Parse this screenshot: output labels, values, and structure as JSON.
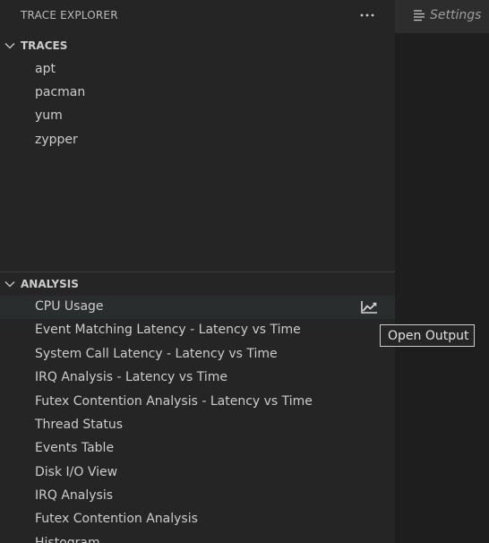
{
  "explorer": {
    "title": "TRACE EXPLORER",
    "more_icon": "ellipsis-icon"
  },
  "traces": {
    "title": "TRACES",
    "items": [
      "apt",
      "pacman",
      "yum",
      "zypper"
    ]
  },
  "analysis": {
    "title": "ANALYSIS",
    "items": [
      "CPU Usage",
      "Event Matching Latency - Latency vs Time",
      "System Call Latency - Latency vs Time",
      "IRQ Analysis - Latency vs Time",
      "Futex Contention Analysis - Latency vs Time",
      "Thread Status",
      "Events Table",
      "Disk I/O View",
      "IRQ Analysis",
      "Futex Contention Analysis",
      "Histogram"
    ],
    "selected_index": 0
  },
  "editor_tab": {
    "label": "Settings",
    "icon": "settings-list-icon"
  },
  "tooltip": {
    "text": "Open Output"
  },
  "colors": {
    "sidebar_bg": "#252526",
    "editor_bg": "#1e1e1e",
    "selected_row": "#2a2d2e",
    "text": "#cccccc"
  }
}
